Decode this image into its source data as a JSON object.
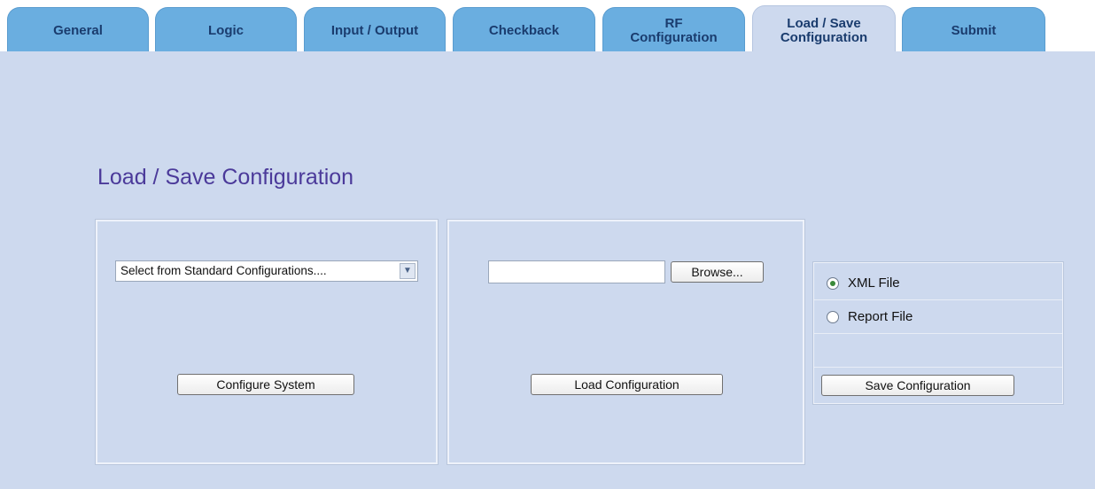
{
  "tabs": [
    {
      "label": "General"
    },
    {
      "label": "Logic"
    },
    {
      "label": "Input / Output"
    },
    {
      "label": "Checkback"
    },
    {
      "label": "RF\nConfiguration"
    },
    {
      "label": "Load / Save\nConfiguration",
      "active": true
    },
    {
      "label": "Submit"
    }
  ],
  "page": {
    "title": "Load / Save Configuration"
  },
  "standard_panel": {
    "select_value": "Select from Standard Configurations....",
    "configure_button": "Configure System"
  },
  "load_panel": {
    "browse_button": "Browse...",
    "load_button": "Load Configuration"
  },
  "save_panel": {
    "options": [
      {
        "label": "XML File",
        "checked": true
      },
      {
        "label": "Report File",
        "checked": false
      }
    ],
    "save_button": "Save Configuration"
  },
  "colors": {
    "tab": "#6aaee0",
    "tab_active": "#cdd9ee",
    "content_bg": "#cdd9ee",
    "title": "#4b3a9a"
  }
}
